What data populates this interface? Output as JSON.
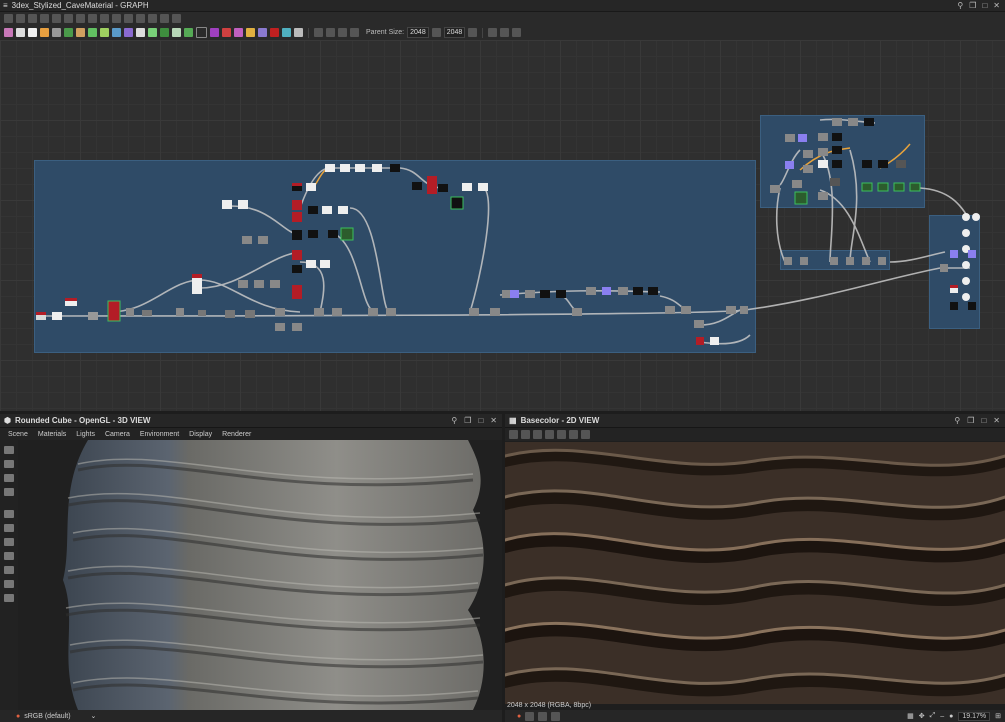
{
  "graph": {
    "title": "3dex_Stylized_CaveMaterial - GRAPH",
    "parent_size_label": "Parent Size:",
    "parent_size_value": "2048",
    "size_value": "2048"
  },
  "view3d": {
    "title": "Rounded Cube - OpenGL - 3D VIEW",
    "menu": [
      "Scene",
      "Materials",
      "Lights",
      "Camera",
      "Environment",
      "Display",
      "Renderer"
    ],
    "colorspace": "sRGB (default)"
  },
  "view2d": {
    "title": "Basecolor - 2D VIEW",
    "info": "2048 x 2048 (RGBA, 8bpc)",
    "zoom": "19.17%"
  },
  "colors": {
    "frame_blue": "#2f4d6a",
    "accent_red": "#b31d26",
    "wire": "#c8c8c8"
  }
}
